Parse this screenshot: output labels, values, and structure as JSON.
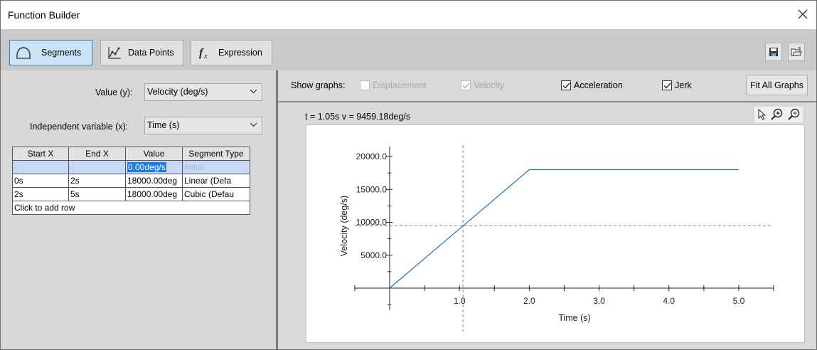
{
  "window": {
    "title": "Function Builder"
  },
  "toolbar": {
    "modes": [
      {
        "label": "Segments",
        "active": true,
        "icon": "segments-icon"
      },
      {
        "label": "Data Points",
        "active": false,
        "icon": "data-points-icon"
      },
      {
        "label": "Expression",
        "active": false,
        "icon": "fx-icon"
      }
    ]
  },
  "left": {
    "value_label": "Value (y):",
    "value_selected": "Velocity (deg/s)",
    "indep_label": "Independent variable (x):",
    "indep_selected": "Time (s)",
    "table": {
      "headers": [
        "Start X",
        "End X",
        "Value",
        "Segment Type"
      ],
      "rows": [
        [
          "-",
          "-",
          "0.00deg/s",
          "Initial"
        ],
        [
          "0s",
          "2s",
          "18000.00deg",
          "Linear (Defa"
        ],
        [
          "2s",
          "5s",
          "18000.00deg",
          "Cubic (Defau"
        ]
      ],
      "add_row": "Click to add row"
    }
  },
  "right": {
    "show_graphs_label": "Show graphs:",
    "graphs": [
      {
        "label": "Displacement",
        "checked": false,
        "enabled": false
      },
      {
        "label": "Velocity",
        "checked": true,
        "enabled": false
      },
      {
        "label": "Acceleration",
        "checked": true,
        "enabled": true
      },
      {
        "label": "Jerk",
        "checked": true,
        "enabled": true
      }
    ],
    "fit_all_label": "Fit All Graphs",
    "readout": "t = 1.05s  v = 9459.18deg/s"
  },
  "chart_data": {
    "type": "line",
    "xlabel": "Time (s)",
    "ylabel": "Velocity (deg/s)",
    "x": [
      0,
      2,
      5
    ],
    "series": [
      {
        "values": [
          0,
          18000,
          18000
        ]
      }
    ],
    "xticks": [
      "1.0",
      "2.0",
      "3.0",
      "4.0",
      "5.0"
    ],
    "yticks": [
      "5000.0",
      "10000.0",
      "15000.0",
      "20000.0"
    ],
    "xlim": [
      0,
      5.5
    ],
    "ylim": [
      -3000,
      21000
    ],
    "cursor": {
      "x": 1.05,
      "y": 9459.18
    },
    "line_color": "#1f6fc0"
  }
}
